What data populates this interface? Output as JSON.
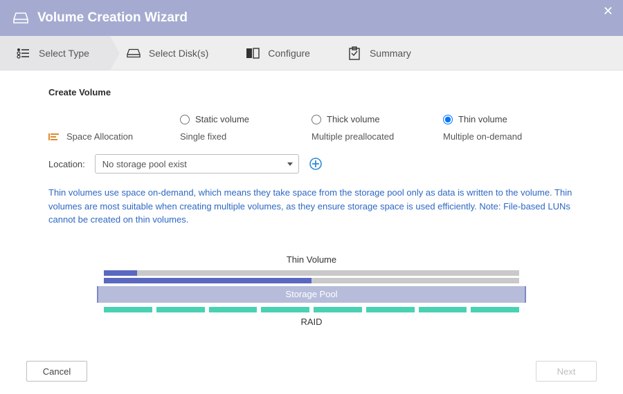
{
  "titlebar": {
    "title": "Volume Creation Wizard"
  },
  "steps": [
    {
      "label": "Select Type"
    },
    {
      "label": "Select Disk(s)"
    },
    {
      "label": "Configure"
    },
    {
      "label": "Summary"
    }
  ],
  "section_heading": "Create Volume",
  "volume_types": {
    "static": {
      "label": "Static volume",
      "desc": "Single fixed"
    },
    "thick": {
      "label": "Thick volume",
      "desc": "Multiple preallocated"
    },
    "thin": {
      "label": "Thin volume",
      "desc": "Multiple on-demand"
    },
    "space_allocation_label": "Space Allocation"
  },
  "location": {
    "label": "Location:",
    "selected": "No storage pool exist"
  },
  "help_text": "Thin volumes use space on-demand, which means they take space from the storage pool only as data is written to the volume. Thin volumes are most suitable when creating multiple volumes, as they ensure storage space is used efficiently. Note: File-based LUNs cannot be created on thin volumes.",
  "diagram": {
    "title": "Thin Volume",
    "pool_label": "Storage Pool",
    "raid_label": "RAID"
  },
  "footer": {
    "cancel": "Cancel",
    "next": "Next"
  },
  "colors": {
    "accent": "#5b68c0",
    "teal": "#48d2b3",
    "link": "#2e68c2"
  }
}
